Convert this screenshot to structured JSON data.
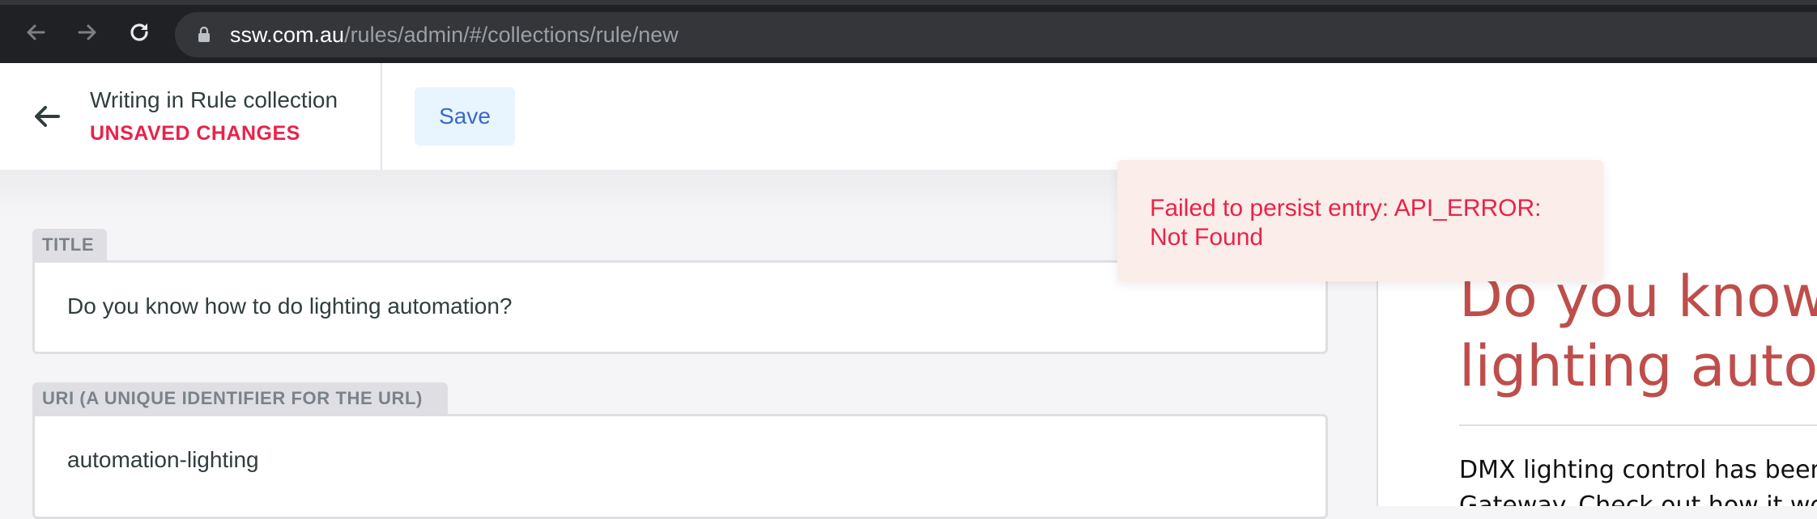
{
  "browser": {
    "url_host": "ssw.com.au",
    "url_path": "/rules/admin/#/collections/rule/new"
  },
  "header": {
    "collection_title": "Writing in Rule collection",
    "status": "UNSAVED CHANGES",
    "save_label": "Save"
  },
  "editor": {
    "fields": [
      {
        "label": "TITLE",
        "value": "Do you know how to do lighting automation?"
      },
      {
        "label": "URI (A UNIQUE IDENTIFIER FOR THE URL)",
        "value": "automation-lighting"
      }
    ]
  },
  "toast": {
    "message": "Failed to persist entry: API_ERROR: Not Found"
  },
  "preview": {
    "title": "Do you know how to do lighting automation?",
    "body": "DMX lighting control has been made simple with the DMX Gateway. Check out how it works"
  },
  "colors": {
    "error": "#e8234a",
    "accent": "#3a69c7",
    "preview_heading": "#be4e4b"
  }
}
